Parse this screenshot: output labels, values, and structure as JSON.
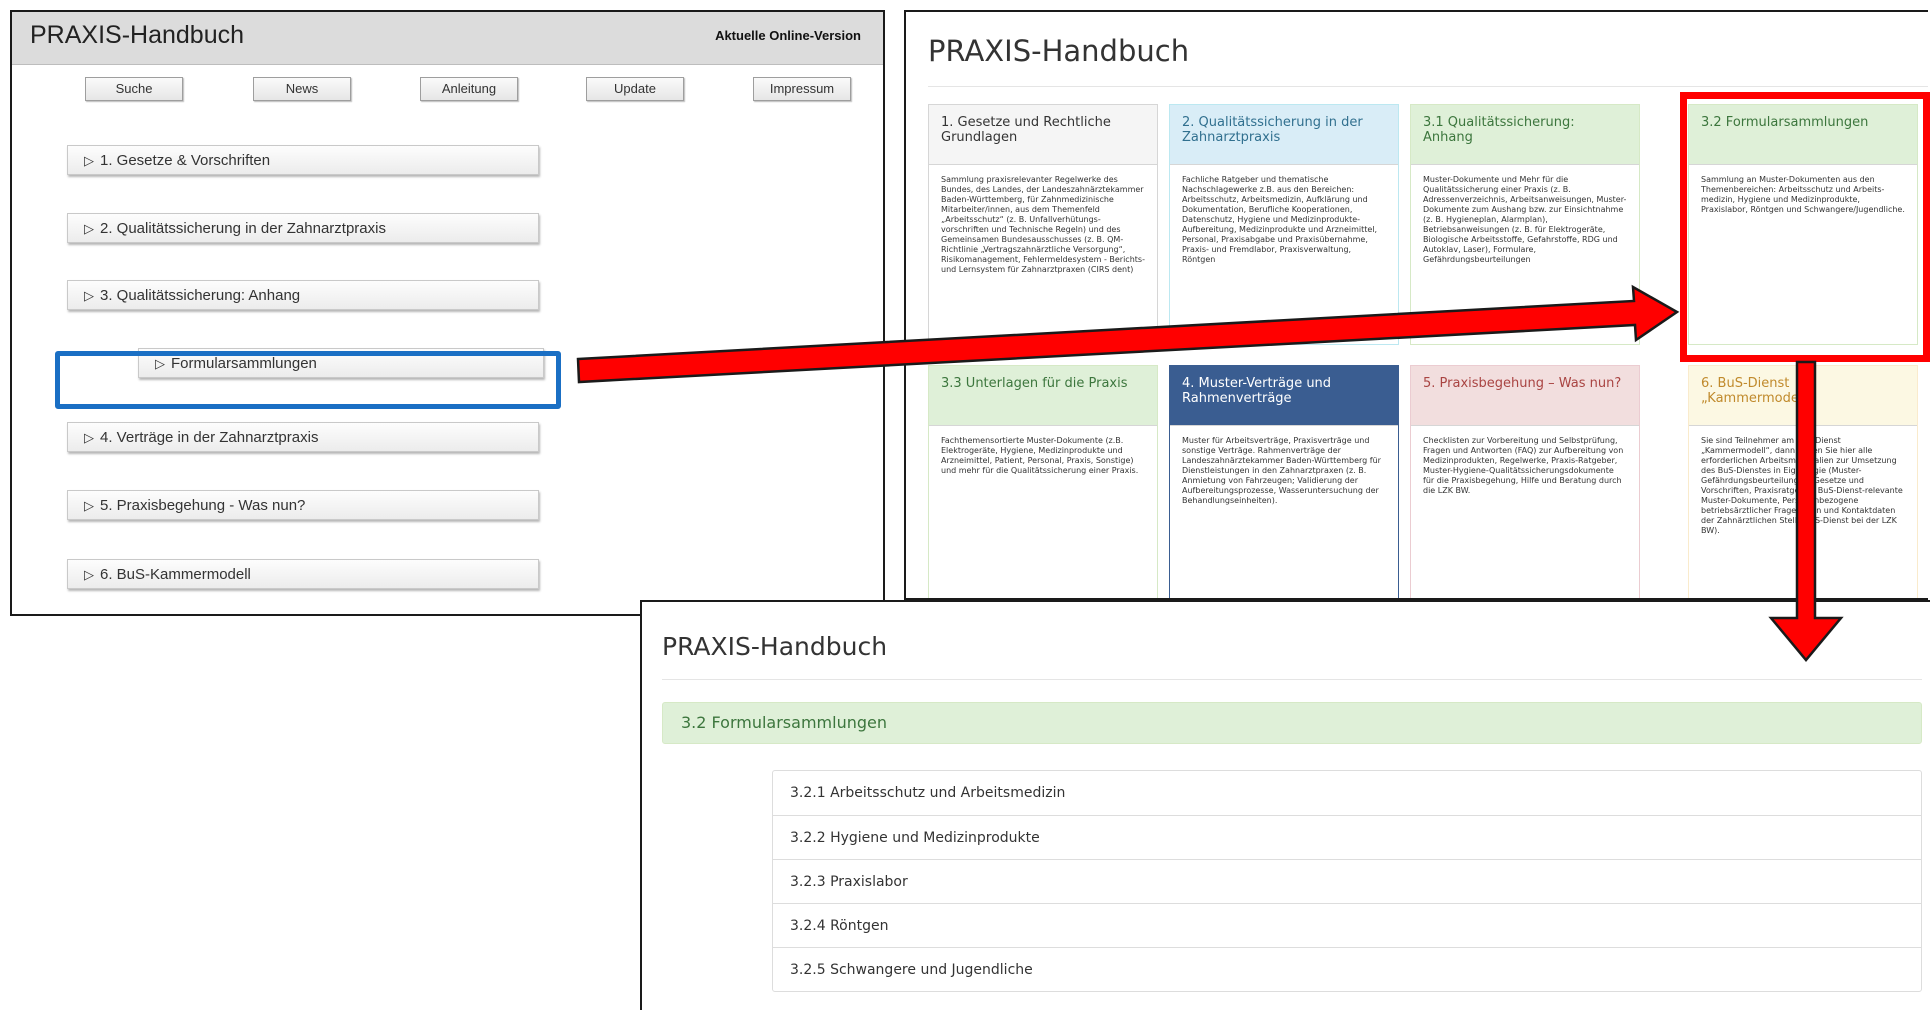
{
  "old": {
    "title": "PRAXIS-Handbuch",
    "online_version": "Aktuelle Online-Version",
    "nav": [
      "Suche",
      "News",
      "Anleitung",
      "Update",
      "Impressum"
    ],
    "items": [
      "1. Gesetze & Vorschriften",
      "2. Qualitätssicherung in der Zahnarztpraxis",
      "3. Qualitätssicherung: Anhang",
      "Formularsammlungen",
      "4. Verträge in der Zahnarztpraxis",
      "5. Praxisbegehung - Was nun?",
      "6. BuS-Kammermodell"
    ],
    "triangle": "▷"
  },
  "mid": {
    "title": "PRAXIS-Handbuch",
    "tiles": [
      {
        "title": "1. Gesetze und Rechtliche Grundlagen",
        "text": "Sammlung praxisrelevanter Regelwerke des Bundes, des Landes, der Landeszahnärztekammer Baden-Württemberg, für Zahnmedizinische Mitarbeiter/innen, aus dem Themenfeld „Arbeitsschutz“ (z. B. Unfallverhütungs-vorschriften und Technische Regeln) und des Gemeinsamen Bundesausschusses (z. B. QM-Richtlinie „Vertragszahnärztliche Versorgung“, Risikomanagement, Fehlermeldesystem - Berichts- und Lernsystem für Zahnarztpraxen (CIRS dent)"
      },
      {
        "title": "2. Qualitätssicherung in der Zahnarztpraxis",
        "text": "Fachliche Ratgeber und thematische Nachschlagewerke z.B. aus den Bereichen: Arbeitsschutz, Arbeitsmedizin, Aufklärung und Dokumentation, Berufliche Kooperationen, Datenschutz, Hygiene und Medizinprodukte-Aufbereitung, Medizinprodukte und Arzneimittel, Personal, Praxisabgabe und Praxisübernahme, Praxis- und Fremdlabor, Praxisverwaltung, Röntgen"
      },
      {
        "title": "3.1 Qualitätssicherung: Anhang",
        "text": "Muster-Dokumente und Mehr für die Qualitätssicherung einer Praxis (z. B. Adressenverzeichnis, Arbeitsanweisungen, Muster-Dokumente zum Aushang bzw. zur Einsichtnahme (z. B. Hygieneplan, Alarmplan), Betriebsanweisungen (z. B. für Elektrogeräte, Biologische Arbeitsstoffe, Gefahrstoffe, RDG und Autoklav, Laser), Formulare, Gefährdungsbeurteilungen"
      },
      {
        "title": "3.2 Formularsammlungen",
        "text": "Sammlung an Muster-Dokumenten aus den Themenbereichen: Arbeitsschutz und Arbeits-medizin, Hygiene und Medizinprodukte, Praxislabor, Röntgen und Schwangere/Jugendliche."
      },
      {
        "title": "3.3 Unterlagen für die Praxis",
        "text": "Fachthemensortierte Muster-Dokumente (z.B. Elektrogeräte, Hygiene, Medizinprodukte und Arzneimittel, Patient, Personal, Praxis, Sonstige) und mehr für die Qualitätssicherung einer Praxis."
      },
      {
        "title": "4. Muster-Verträge und Rahmenverträge",
        "text": "Muster für Arbeitsverträge, Praxisverträge und sonstige Verträge. Rahmenverträge der Landeszahnärztekammer Baden-Württemberg für Dienstleistungen in den Zahnarztpraxen (z. B. Anmietung von Fahrzeugen; Validierung der Aufbereitungsprozesse, Wasseruntersuchung der Behandlungseinheiten)."
      },
      {
        "title": "5. Praxisbegehung – Was nun?",
        "text": "Checklisten zur Vorbereitung und Selbstprüfung, Fragen und Antworten (FAQ) zur Aufbereitung von Medizinprodukten, Regelwerke, Praxis-Ratgeber, Muster-Hygiene-Qualitätssicherungsdokumente für die Praxisbegehung, Hilfe und Beratung durch die LZK BW."
      },
      {
        "title": "6. BuS-Dienst „Kammermodell“",
        "text": "Sie sind Teilnehmer am BuS-Dienst „Kammermodell“, dann finden Sie hier alle erforderlichen Arbeitsmaterialien zur Umsetzung des BuS-Dienstes in Eigenregie (Muster-Gefährdungsbeurteilungen, Gesetze und Vorschriften, Praxisratgeber, BuS-Dienst-relevante Muster-Dokumente, Personenbezogene betriebsärztlicher Fragebogen und Kontaktdaten der Zahnärztlichen Stelle BuS-Dienst bei der LZK BW)."
      }
    ]
  },
  "bottom": {
    "title": "PRAXIS-Handbuch",
    "panel": "3.2 Formularsammlungen",
    "items": [
      "3.2.1 Arbeitsschutz und Arbeitsmedizin",
      "3.2.2 Hygiene und Medizinprodukte",
      "3.2.3 Praxislabor",
      "3.2.4 Röntgen",
      "3.2.5 Schwangere und Jugendliche"
    ]
  },
  "colors": {
    "highlight_blue": "#1a6fc4",
    "highlight_red": "#ff0000",
    "arrow": "#ff0000"
  }
}
